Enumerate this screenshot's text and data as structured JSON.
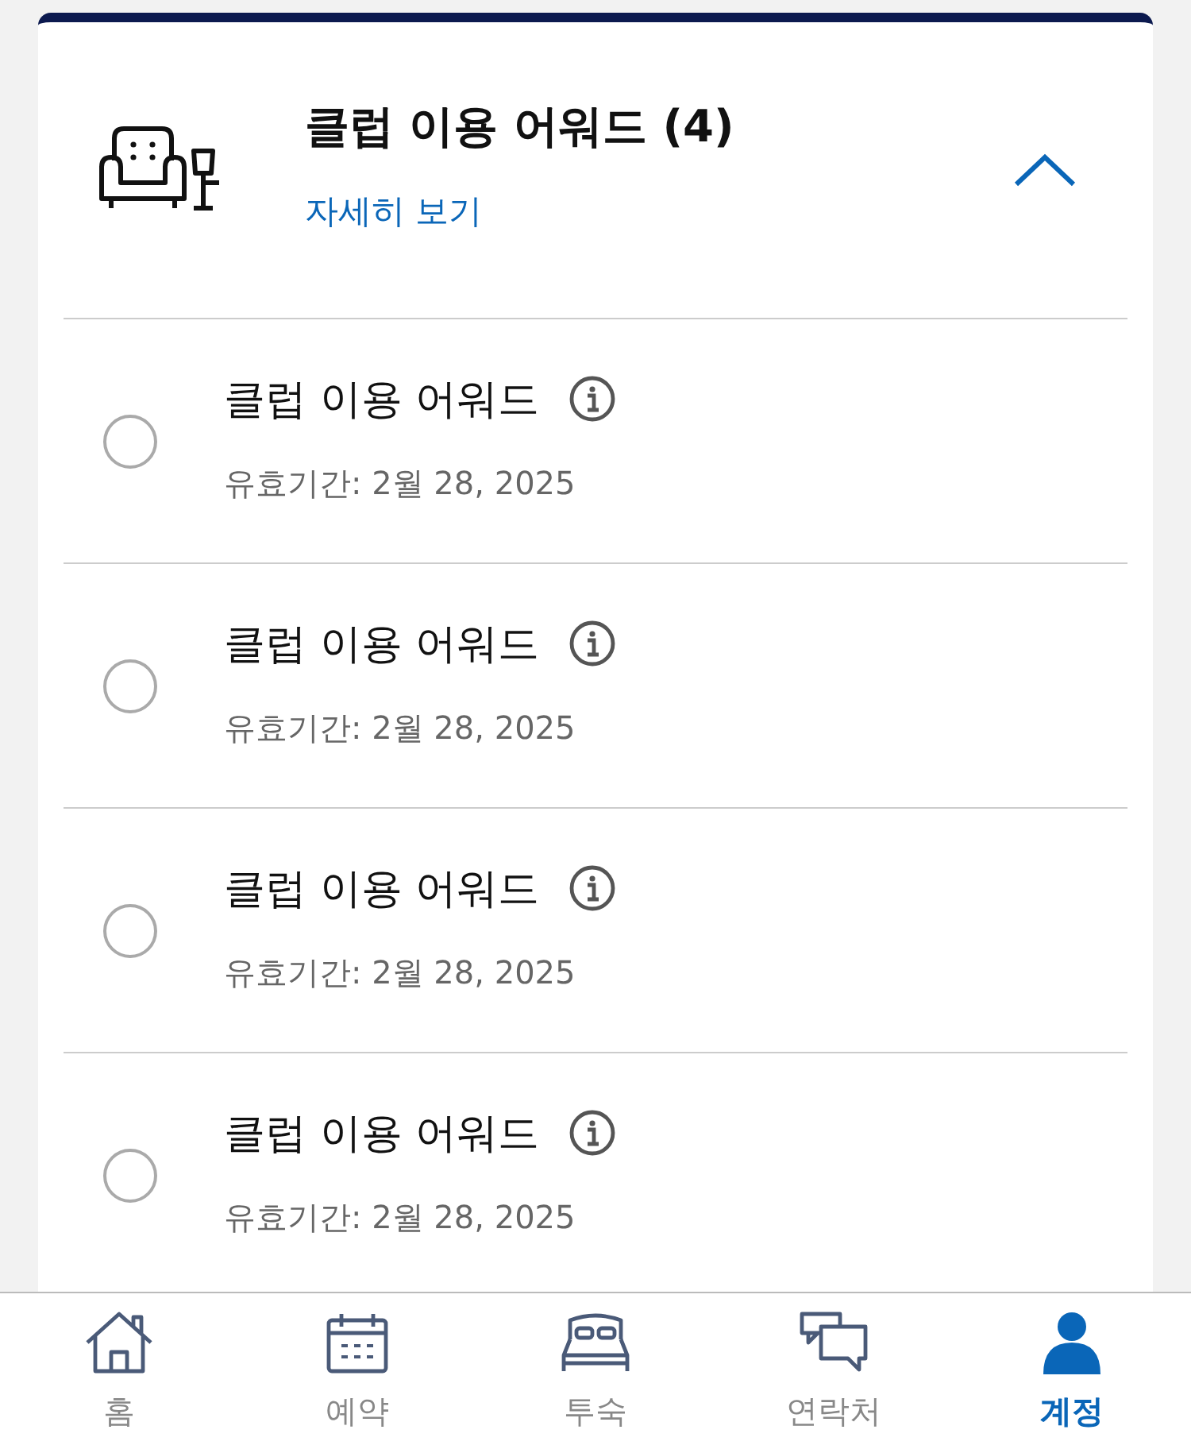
{
  "header": {
    "title": "클럽 이용 어워드 (4)",
    "link": "자세히 보기",
    "expanded": true
  },
  "awards": [
    {
      "title": "클럽 이용 어워드",
      "expiry": "유효기간: 2월 28, 2025",
      "selected": false
    },
    {
      "title": "클럽 이용 어워드",
      "expiry": "유효기간: 2월 28, 2025",
      "selected": false
    },
    {
      "title": "클럽 이용 어워드",
      "expiry": "유효기간: 2월 28, 2025",
      "selected": false
    },
    {
      "title": "클럽 이용 어워드",
      "expiry": "유효기간: 2월 28, 2025",
      "selected": false
    }
  ],
  "nav": [
    {
      "kind": "home",
      "label": "홈",
      "selected": false
    },
    {
      "kind": "calendar",
      "label": "예약",
      "selected": false
    },
    {
      "kind": "bed",
      "label": "투숙",
      "selected": false
    },
    {
      "kind": "chat",
      "label": "연락처",
      "selected": false
    },
    {
      "kind": "person",
      "label": "계정",
      "selected": true
    }
  ]
}
